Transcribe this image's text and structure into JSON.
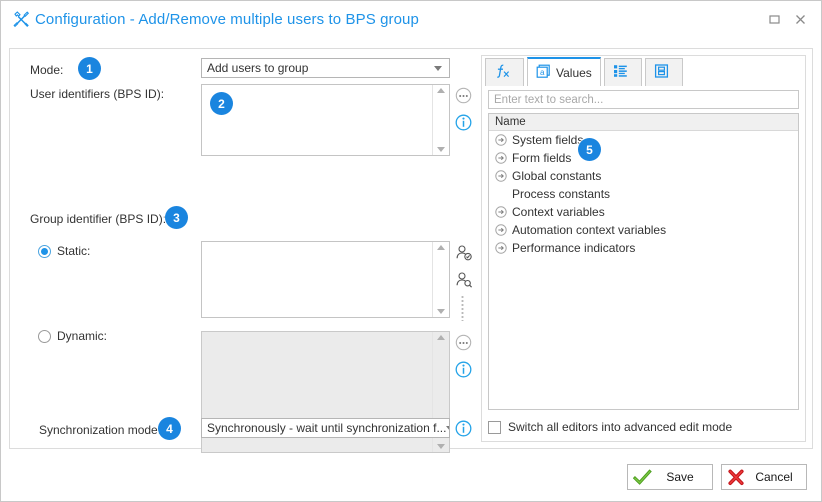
{
  "window": {
    "title": "Configuration - Add/Remove multiple users to BPS group",
    "title_icon": "tools-icon",
    "maximize_icon": "maximize-icon",
    "close_icon": "close-icon"
  },
  "form": {
    "mode_label": "Mode:",
    "mode_badge": "1",
    "mode_value": "Add users to group",
    "user_ids_label": "User identifiers (BPS ID):",
    "user_ids_badge": "2",
    "user_ids_value": "",
    "group_id_label": "Group identifier (BPS ID):",
    "group_id_badge": "3",
    "static_label": "Static:",
    "static_selected": true,
    "static_value": "",
    "dynamic_label": "Dynamic:",
    "dynamic_selected": false,
    "dynamic_value": "",
    "sync_label": "Synchronization mode:",
    "sync_badge": "4",
    "sync_value": "Synchronously - wait until synchronization f...",
    "icons": {
      "ellipsis": "ellipsis-icon",
      "info": "info-icon",
      "user_check": "user-check-icon",
      "user_search": "user-search-icon"
    }
  },
  "values_panel": {
    "tabs": [
      {
        "label": "",
        "icon": "function-fx-icon",
        "active": false
      },
      {
        "label": "Values",
        "icon": "values-document-icon",
        "active": true
      },
      {
        "label": "",
        "icon": "list-grid-icon",
        "active": false
      },
      {
        "label": "",
        "icon": "form-layout-icon",
        "active": false
      }
    ],
    "search_placeholder": "Enter text to search...",
    "tree_header": "Name",
    "tree_badge": "5",
    "tree_items": [
      {
        "label": "System fields",
        "expandable": true
      },
      {
        "label": "Form fields",
        "expandable": true
      },
      {
        "label": "Global constants",
        "expandable": true
      },
      {
        "label": "Process constants",
        "expandable": false
      },
      {
        "label": "Context variables",
        "expandable": true
      },
      {
        "label": "Automation context variables",
        "expandable": true
      },
      {
        "label": "Performance indicators",
        "expandable": true
      }
    ],
    "advanced_checkbox_label": "Switch all editors into advanced edit mode",
    "advanced_checkbox_checked": false
  },
  "footer": {
    "save_label": "Save",
    "save_icon": "green-check-icon",
    "cancel_label": "Cancel",
    "cancel_icon": "red-cross-icon"
  },
  "colors": {
    "accent": "#1e93e8",
    "badge": "#1a85df",
    "save": "#55a630",
    "cancel": "#cc2127"
  }
}
